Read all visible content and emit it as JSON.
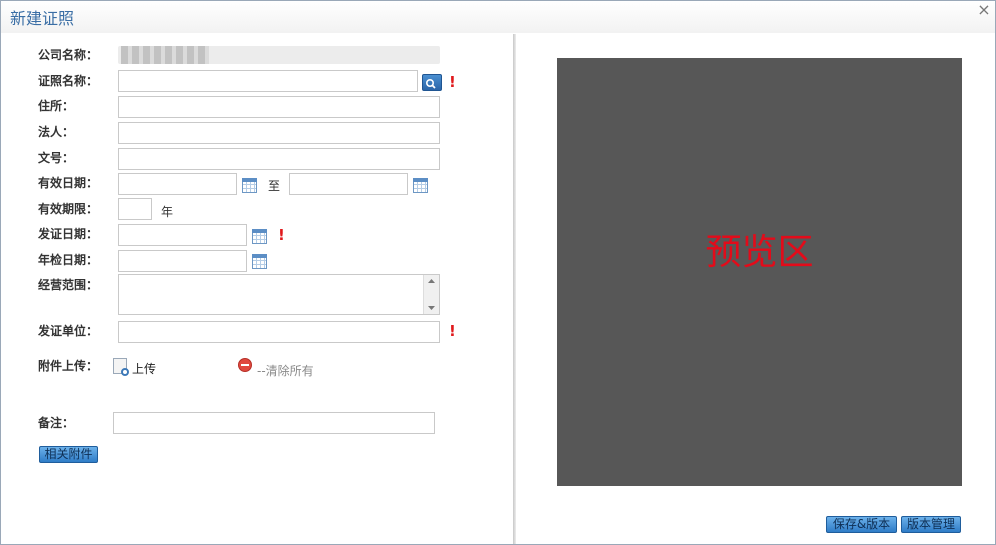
{
  "dialog": {
    "title": "新建证照",
    "close_label": "×"
  },
  "form": {
    "company_label": "公司名称：",
    "license_name_label": "证照名称：",
    "address_label": "住所：",
    "legal_person_label": "法人：",
    "doc_number_label": "文号：",
    "valid_date_label": "有效日期：",
    "valid_to_text": "至",
    "valid_period_label": "有效期限：",
    "year_unit": "年",
    "issue_date_label": "发证日期：",
    "annual_check_label": "年检日期：",
    "business_scope_label": "经营范围：",
    "issuer_label": "发证单位：",
    "attachment_label": "附件上传：",
    "upload_text": "上传",
    "clear_all_text": "--清除所有",
    "remarks_label": "备注：",
    "related_attach_button": "相关附件",
    "required_mark": "!"
  },
  "preview": {
    "placeholder": "预览区"
  },
  "actions": {
    "save_version": "保存&版本",
    "version_manage": "版本管理"
  },
  "colors": {
    "title": "#3a6ea5",
    "required": "#e0191c",
    "preview_bg": "#575757",
    "preview_text": "#e30b1a",
    "button_top": "#6cb1ea",
    "button_bottom": "#2f7cc7"
  }
}
